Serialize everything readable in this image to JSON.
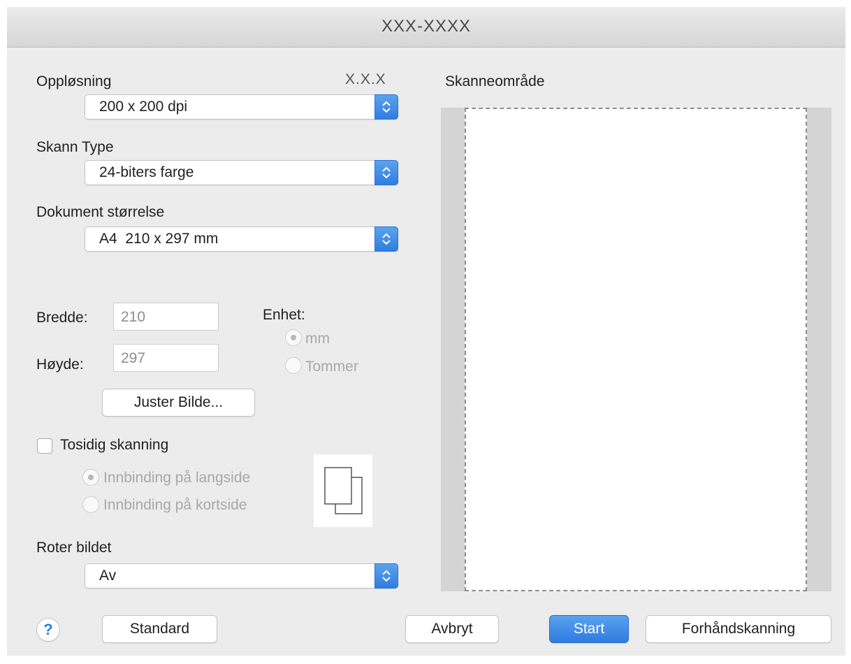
{
  "window": {
    "title": "XXX-XXXX"
  },
  "resolution": {
    "label": "Oppløsning",
    "badge": "X.X.X",
    "value": "200 x 200 dpi"
  },
  "scan_type": {
    "label": "Skann Type",
    "value": "24-biters farge"
  },
  "document_size": {
    "label": "Dokument størrelse",
    "value": "A4  210 x 297 mm"
  },
  "dimensions": {
    "width_label": "Bredde:",
    "width_value": "210",
    "height_label": "Høyde:",
    "height_value": "297",
    "unit_label": "Enhet:",
    "unit_options": [
      {
        "label": "mm",
        "selected": true
      },
      {
        "label": "Tommer",
        "selected": false
      }
    ]
  },
  "adjust_image_button": "Juster Bilde...",
  "duplex": {
    "label": "Tosidig skanning",
    "checked": false,
    "options": [
      {
        "label": "Innbinding på langside",
        "selected": true
      },
      {
        "label": "Innbinding på kortside",
        "selected": false
      }
    ]
  },
  "rotate": {
    "label": "Roter bildet",
    "value": "Av"
  },
  "scan_area": {
    "label": "Skanneområde"
  },
  "footer": {
    "help": "?",
    "default_button": "Standard",
    "cancel_button": "Avbryt",
    "start_button": "Start",
    "prescan_button": "Forhåndskanning"
  },
  "colors": {
    "accent": "#2f7de0",
    "disabled": "#a8a8a8",
    "window_bg": "#ececec"
  },
  "icons": [
    "chevron-updown-icon",
    "duplex-pages-icon",
    "help-icon"
  ]
}
